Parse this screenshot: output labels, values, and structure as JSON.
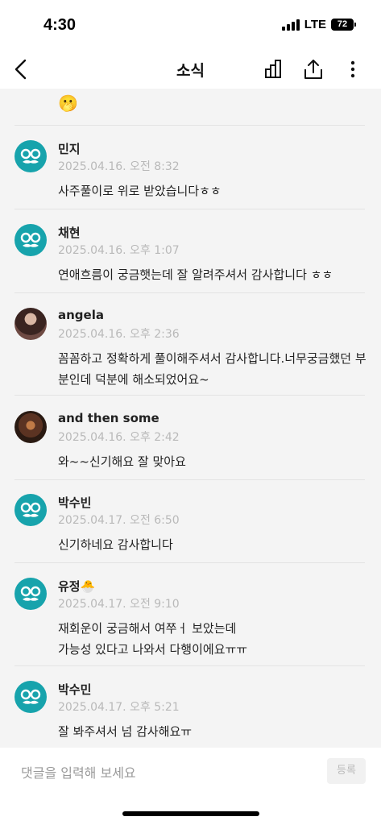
{
  "status": {
    "time": "4:30",
    "network": "LTE",
    "battery": "72"
  },
  "nav": {
    "title": "소식",
    "back_icon": "chevron-left-icon",
    "stats_icon": "bar-chart-icon",
    "share_icon": "share-icon",
    "more_icon": "more-vertical-icon"
  },
  "top_emoji": "🫢",
  "comments": [
    {
      "name": "민지",
      "date": "2025.04.16. 오전 8:32",
      "text": "사주풀이로 위로 받았습니다ㅎㅎ",
      "avatar": "default"
    },
    {
      "name": "채현",
      "date": "2025.04.16. 오후 1:07",
      "text": "연애흐름이 궁금햇는데 잘 알려주셔서 감사합니다 ㅎㅎ",
      "avatar": "default"
    },
    {
      "name": "angela",
      "date": "2025.04.16. 오후 2:36",
      "text": "꼼꼼하고 정확하게 풀이해주셔서 감사합니다.너무궁금했던 부분인데 덕분에 해소되었어요~",
      "avatar": "photo"
    },
    {
      "name": "and then some",
      "date": "2025.04.16. 오후 2:42",
      "text": "와~~신기해요 잘 맞아요",
      "avatar": "photo"
    },
    {
      "name": "박수빈",
      "date": "2025.04.17. 오전 6:50",
      "text": "신기하네요 감사합니다",
      "avatar": "default"
    },
    {
      "name": "유정🐣",
      "date": "2025.04.17. 오전 9:10",
      "text": "재회운이 궁금해서 여쭈ㅓ 보았는데\n가능성 있다고 나와서 다행이에요ㅠㅠ",
      "avatar": "default"
    },
    {
      "name": "박수민",
      "date": "2025.04.17. 오후 5:21",
      "text": "잘 봐주셔서 넘 감사해요ㅠ",
      "avatar": "default"
    }
  ],
  "composer": {
    "placeholder": "댓글을 입력해 보세요",
    "submit_label": "등록"
  },
  "colors": {
    "avatar_teal": "#17a3ac",
    "date_gray": "#b9b9b9",
    "background": "#f4f4f4"
  }
}
